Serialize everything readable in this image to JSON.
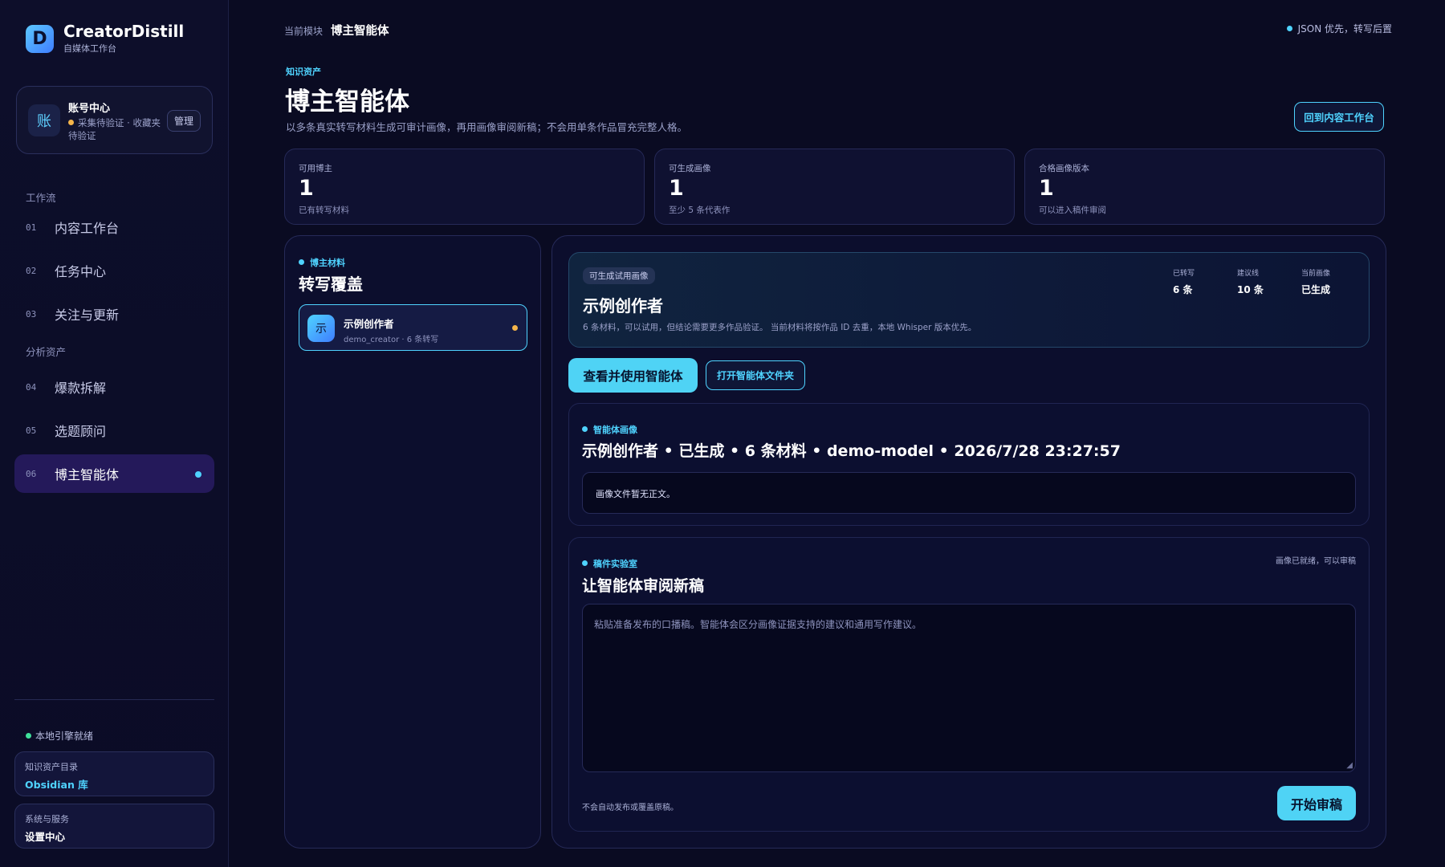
{
  "brand": {
    "logo_letter": "D",
    "name": "CreatorDistill",
    "subtitle": "自媒体工作台"
  },
  "account": {
    "avatar": "账",
    "title": "账号中心",
    "status": "采集待验证 · 收藏夹待验证",
    "manage_label": "管理",
    "status_color": "#f5b54a"
  },
  "sidebar": {
    "section_workflow": "工作流",
    "section_analysis": "分析资产",
    "items": [
      {
        "num": "01",
        "label": "内容工作台"
      },
      {
        "num": "02",
        "label": "任务中心"
      },
      {
        "num": "03",
        "label": "关注与更新"
      },
      {
        "num": "04",
        "label": "爆款拆解"
      },
      {
        "num": "05",
        "label": "选题顾问"
      },
      {
        "num": "06",
        "label": "博主智能体",
        "active": true
      }
    ],
    "engine_status": "本地引擎就绪",
    "knowledge": {
      "label": "知识资产目录",
      "value": "Obsidian 库"
    },
    "system": {
      "label": "系统与服务",
      "value": "设置中心"
    }
  },
  "topbar": {
    "crumb_label": "当前模块",
    "crumb_current": "博主智能体",
    "right_status": "JSON 优先，转写后置"
  },
  "header": {
    "eyebrow": "知识资产",
    "title": "博主智能体",
    "description": "以多条真实转写材料生成可审计画像，再用画像审阅新稿；不会用单条作品冒充完整人格。",
    "back_button": "回到内容工作台"
  },
  "stats": [
    {
      "label": "可用博主",
      "value": "1",
      "sub": "已有转写材料"
    },
    {
      "label": "可生成画像",
      "value": "1",
      "sub": "至少 5 条代表作"
    },
    {
      "label": "合格画像版本",
      "value": "1",
      "sub": "可以进入稿件审阅"
    }
  ],
  "left_panel": {
    "tag": "博主材料",
    "title": "转写覆盖",
    "creator": {
      "avatar": "示",
      "name": "示例创作者",
      "meta": "demo_creator · 6 条转写"
    }
  },
  "hero": {
    "chip": "可生成试用画像",
    "name": "示例创作者",
    "description": "6 条材料，可以试用，但结论需要更多作品验证。 当前材料将按作品 ID 去重，本地 Whisper 版本优先。",
    "stats": [
      {
        "label": "已转写",
        "value": "6 条"
      },
      {
        "label": "建议线",
        "value": "10 条"
      },
      {
        "label": "当前画像",
        "value": "已生成"
      }
    ]
  },
  "actions": {
    "primary": "查看并使用智能体",
    "secondary": "打开智能体文件夹"
  },
  "portrait": {
    "tag": "智能体画像",
    "title": "示例创作者 • 已生成 • 6 条材料 • demo-model • 2026/7/28 23:27:57",
    "body": "画像文件暂无正文。"
  },
  "lab": {
    "tag": "稿件实验室",
    "status": "画像已就绪，可以审稿",
    "title": "让智能体审阅新稿",
    "placeholder": "粘贴准备发布的口播稿。智能体会区分画像证据支持的建议和通用写作建议。",
    "note": "不会自动发布或覆盖原稿。",
    "button": "开始审稿"
  }
}
